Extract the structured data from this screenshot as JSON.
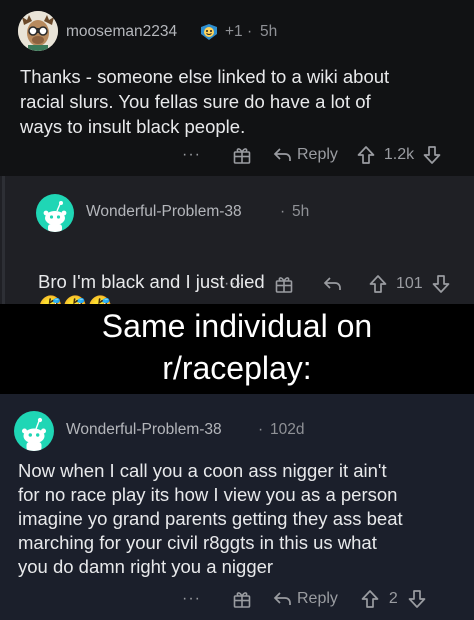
{
  "comments": [
    {
      "username": "mooseman2234",
      "flair": "+1",
      "dot": "·",
      "time": "5h",
      "body": "Thanks - someone else linked to a wiki about\nracial slurs. You fellas sure do have a lot of\nways to insult black people.",
      "reply_label": "Reply",
      "score": "1.2k"
    },
    {
      "username": "Wonderful-Problem-38",
      "dot": "·",
      "time": "5h",
      "body": "Bro I'm black and I just died",
      "emojis": "🤣🤣🤣",
      "score": "101"
    },
    {
      "username": "Wonderful-Problem-38",
      "dot": "·",
      "time": "102d",
      "body": "Now when I call you a coon ass nigger it ain't\nfor no race play its how I view you as a person\nimagine yo grand parents getting they ass beat\nmarching for your civil r8ggts in this us what\nyou do damn right you a nigger",
      "reply_label": "Reply",
      "score": "2"
    }
  ],
  "banner": {
    "line1": "Same individual on",
    "line2": "r/raceplay:"
  },
  "more_dots": "···",
  "colors": {
    "panel_dark": "#111214",
    "panel_reply": "#1f2025",
    "panel_blue": "#1b1f2b",
    "text": "#e8e9eb",
    "muted": "#8f9196",
    "avatar_teal": "#1fd6b5"
  },
  "icons": [
    "moose-avatar-icon",
    "snoo-avatar-icon",
    "award-icon",
    "reply-arrow-icon",
    "upvote-icon",
    "downvote-icon",
    "gift-icon"
  ]
}
